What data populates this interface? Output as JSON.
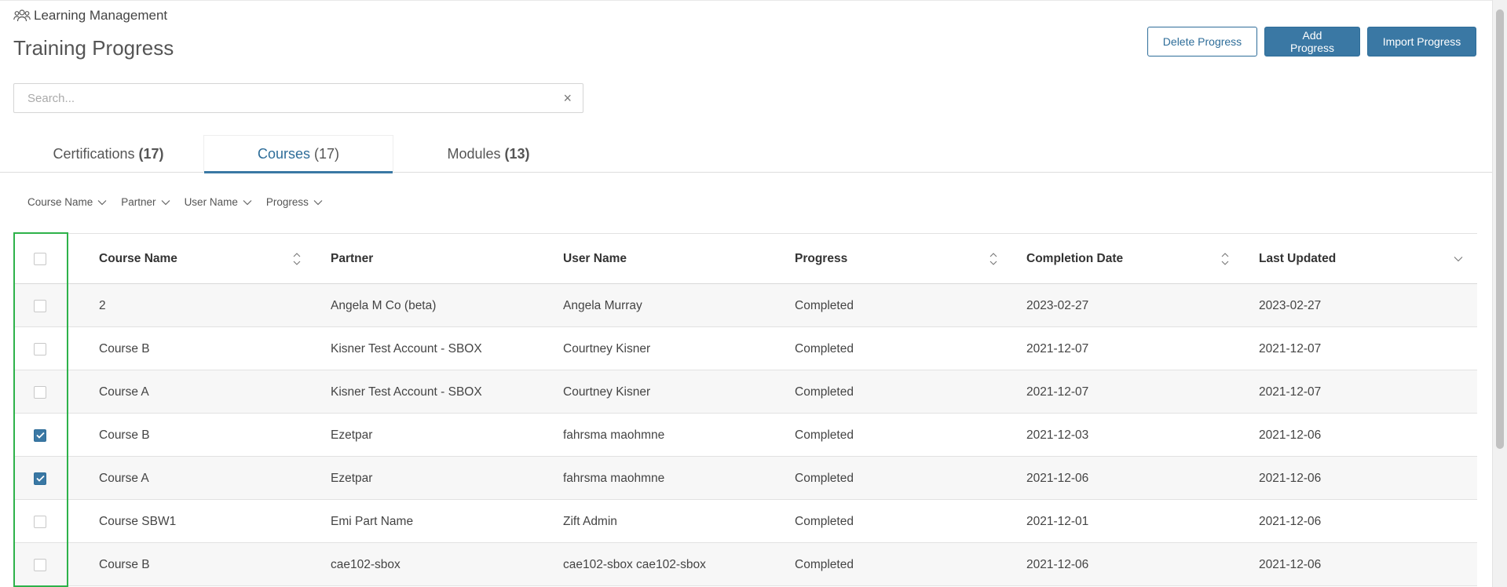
{
  "header": {
    "breadcrumb": "Learning Management",
    "title": "Training Progress",
    "actions": {
      "delete": "Delete Progress",
      "add": "Add Progress",
      "import": "Import Progress"
    }
  },
  "search": {
    "placeholder": "Search...",
    "value": "",
    "clear": "×"
  },
  "tabs": [
    {
      "label": "Certifications",
      "count": "(17)"
    },
    {
      "label": "Courses",
      "count": "(17)"
    },
    {
      "label": "Modules",
      "count": "(13)"
    }
  ],
  "filters": [
    "Course Name",
    "Partner",
    "User Name",
    "Progress"
  ],
  "table": {
    "columns": {
      "name": "Course Name",
      "partner": "Partner",
      "user": "User Name",
      "progress": "Progress",
      "completion": "Completion Date",
      "updated": "Last Updated"
    },
    "rows": [
      {
        "checked": false,
        "name": "2",
        "partner": "Angela M Co (beta)",
        "user": "Angela Murray",
        "progress": "Completed",
        "completion": "2023-02-27",
        "updated": "2023-02-27"
      },
      {
        "checked": false,
        "name": "Course B",
        "partner": "Kisner Test Account - SBOX",
        "user": "Courtney Kisner",
        "progress": "Completed",
        "completion": "2021-12-07",
        "updated": "2021-12-07"
      },
      {
        "checked": false,
        "name": "Course A",
        "partner": "Kisner Test Account - SBOX",
        "user": "Courtney Kisner",
        "progress": "Completed",
        "completion": "2021-12-07",
        "updated": "2021-12-07"
      },
      {
        "checked": true,
        "name": "Course B",
        "partner": "Ezetpar",
        "user": "fahrsma maohmne",
        "progress": "Completed",
        "completion": "2021-12-03",
        "updated": "2021-12-06"
      },
      {
        "checked": true,
        "name": "Course A",
        "partner": "Ezetpar",
        "user": "fahrsma maohmne",
        "progress": "Completed",
        "completion": "2021-12-06",
        "updated": "2021-12-06"
      },
      {
        "checked": false,
        "name": "Course SBW1",
        "partner": "Emi Part Name",
        "user": "Zift Admin",
        "progress": "Completed",
        "completion": "2021-12-01",
        "updated": "2021-12-06"
      },
      {
        "checked": false,
        "name": "Course B",
        "partner": "cae102-sbox",
        "user": "cae102-sbox cae102-sbox",
        "progress": "Completed",
        "completion": "2021-12-06",
        "updated": "2021-12-06"
      }
    ]
  },
  "colors": {
    "accent": "#3a78a4",
    "highlight": "#2eb24a"
  },
  "icons": {
    "breadcrumb": "users-group-icon",
    "sort": "sort-updown-icon",
    "filter": "chevron-down-icon"
  }
}
